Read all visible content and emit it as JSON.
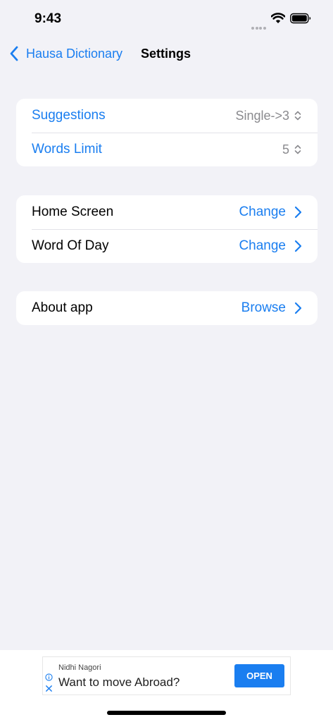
{
  "status_bar": {
    "time": "9:43"
  },
  "nav": {
    "back_label": "Hausa Dictionary",
    "title": "Settings"
  },
  "groups": [
    {
      "rows": [
        {
          "label": "Suggestions",
          "value": "Single->3"
        },
        {
          "label": "Words Limit",
          "value": "5"
        }
      ]
    },
    {
      "rows": [
        {
          "label": "Home Screen",
          "value": "Change"
        },
        {
          "label": "Word Of Day",
          "value": "Change"
        }
      ]
    },
    {
      "rows": [
        {
          "label": "About app",
          "value": "Browse"
        }
      ]
    }
  ],
  "ad": {
    "advertiser": "Nidhi Nagori",
    "headline": "Want to move Abroad?",
    "cta": "OPEN"
  },
  "colors": {
    "accent": "#1a7ef0",
    "background": "#f2f2f7",
    "secondary_text": "#8a8a8e"
  }
}
